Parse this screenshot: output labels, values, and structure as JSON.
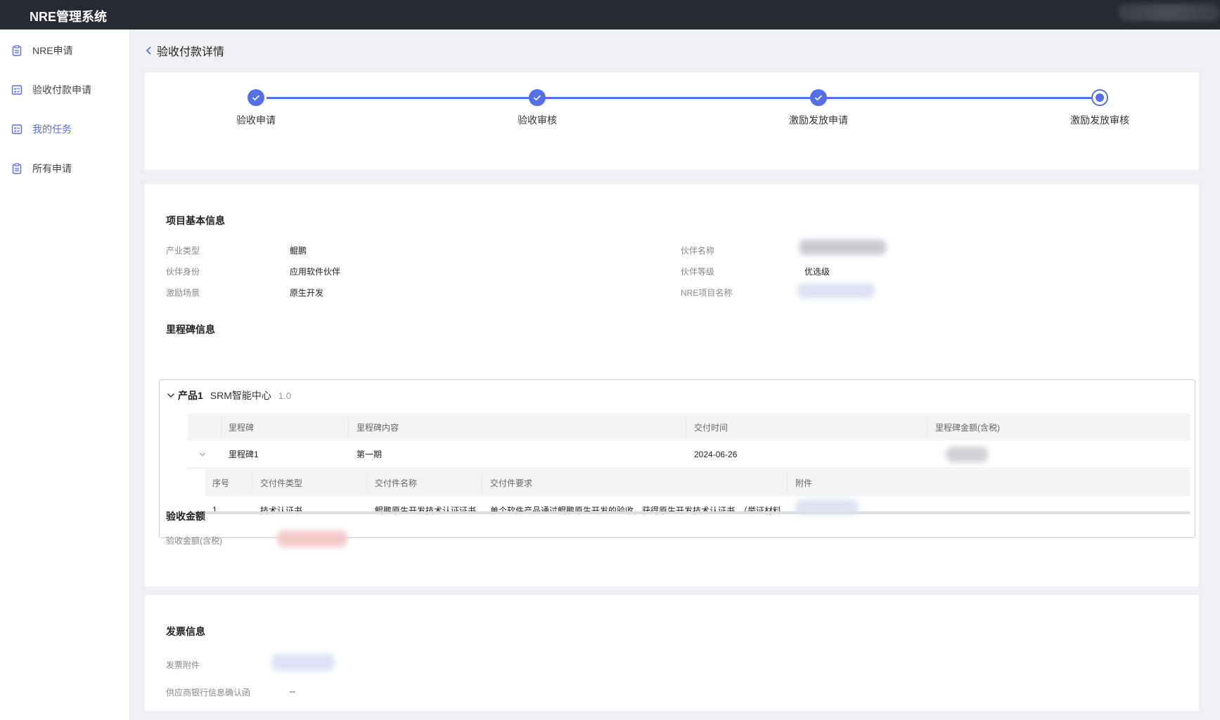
{
  "app": {
    "title": "NRE管理系统"
  },
  "sidebar": {
    "items": [
      {
        "label": "NRE申请",
        "icon": "clipboard-icon",
        "active": false
      },
      {
        "label": "验收付款申请",
        "icon": "checklist-icon",
        "active": false
      },
      {
        "label": "我的任务",
        "icon": "checklist-icon",
        "active": true
      },
      {
        "label": "所有申请",
        "icon": "clipboard-icon",
        "active": false
      }
    ]
  },
  "page": {
    "back_title": "验收付款详情"
  },
  "steps": [
    {
      "label": "验收申请",
      "status": "done"
    },
    {
      "label": "验收审核",
      "status": "done"
    },
    {
      "label": "激励发放申请",
      "status": "done"
    },
    {
      "label": "激励发放审核",
      "status": "current"
    }
  ],
  "basic_info": {
    "title": "项目基本信息",
    "industry_type_label": "产业类型",
    "industry_type_value": "鲲鹏",
    "partner_identity_label": "伙伴身份",
    "partner_identity_value": "应用软件伙伴",
    "incentive_scene_label": "激励场景",
    "incentive_scene_value": "原生开发",
    "partner_name_label": "伙伴名称",
    "partner_level_label": "伙伴等级",
    "partner_level_value": "优选级",
    "nre_project_label": "NRE项目名称"
  },
  "milestone": {
    "title": "里程碑信息",
    "product_label": "产品1",
    "product_name": "SRM智能中心",
    "product_version": "1.0",
    "headers": [
      "里程碑",
      "里程碑内容",
      "交付时间",
      "里程碑金额(含税)"
    ],
    "row": {
      "name": "里程碑1",
      "content": "第一期",
      "date": "2024-06-26"
    },
    "sub_headers": [
      "序号",
      "交付件类型",
      "交付件名称",
      "交付件要求",
      "附件"
    ],
    "sub_row": {
      "index": "1",
      "type": "技术认证书",
      "name": "鲲鹏原生开发技术认证证书",
      "requirement": "单个软件产品通过鲲鹏原生开发的验收，获得原生开发技术认证书。（举证材料：鲲..."
    }
  },
  "acceptance": {
    "title": "验收金额",
    "amount_label": "验收金额(含税)"
  },
  "invoice": {
    "title": "发票信息",
    "attachment_label": "发票附件",
    "bank_confirm_label": "供应商银行信息确认函",
    "bank_confirm_value": "--"
  },
  "colors": {
    "accent": "#5470e8",
    "topbar": "#272a33"
  }
}
